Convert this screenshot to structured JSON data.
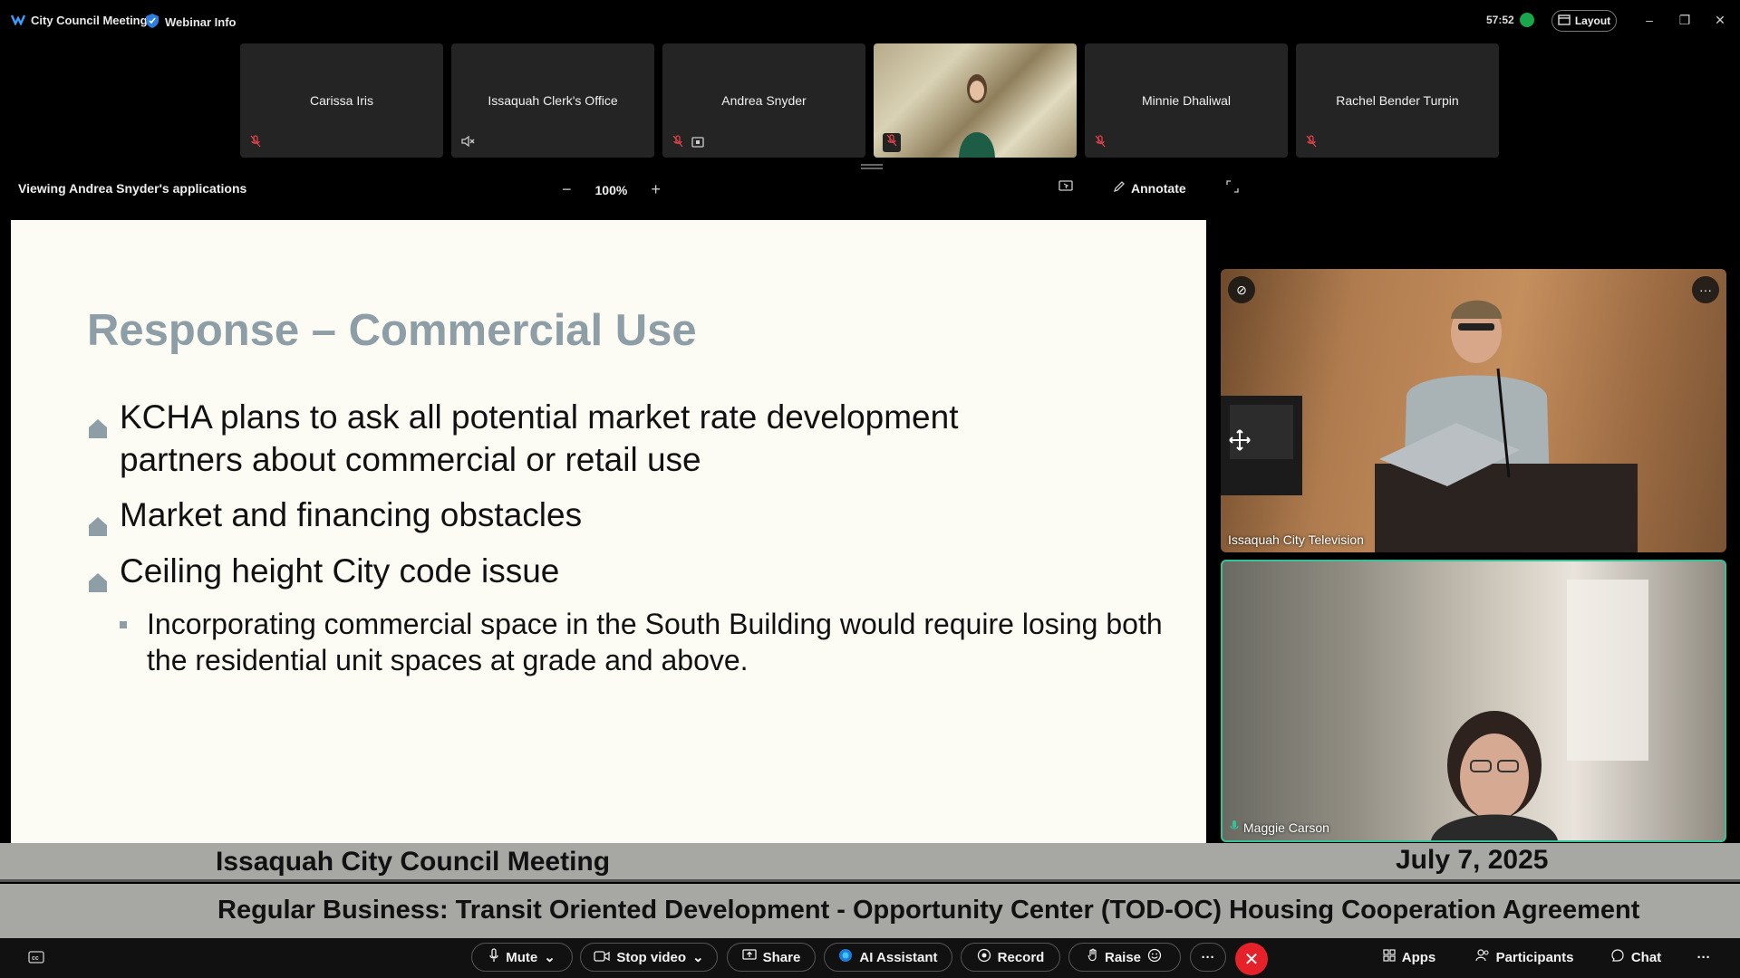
{
  "topbar": {
    "app_title": "City Council Meeting",
    "webinar_info": "Webinar Info",
    "timer": "57:52",
    "layout_label": "Layout"
  },
  "participants": [
    {
      "name": "Carissa Iris",
      "icon": "mic-muted-icon"
    },
    {
      "name": "Issaquah Clerk's Office",
      "icon": "speaker-muted-icon"
    },
    {
      "name": "Andrea Snyder",
      "icon": "mic-muted-icon"
    },
    {
      "name": "",
      "icon": "mic-muted-icon",
      "video": true
    },
    {
      "name": "Minnie Dhaliwal",
      "icon": "mic-muted-icon"
    },
    {
      "name": "Rachel Bender Turpin",
      "icon": "mic-muted-icon"
    }
  ],
  "share": {
    "viewing_label": "Viewing Andrea Snyder's applications",
    "zoom_level": "100%",
    "annotate_label": "Annotate"
  },
  "slide": {
    "title": "Response – Commercial Use",
    "bullets": [
      "KCHA plans to ask all potential market rate development partners about commercial or retail use",
      "Market and financing obstacles",
      "Ceiling height City code issue"
    ],
    "sub_bullet": "Incorporating commercial space in the South Building would require losing both the residential unit spaces at grade and above."
  },
  "videos": {
    "cam1_label": "Issaquah City Television",
    "cam2_label": "Maggie Carson"
  },
  "lower_third": {
    "meeting": "Issaquah City Council Meeting",
    "date": "July 7, 2025",
    "topic": "Regular Business: Transit Oriented Development - Opportunity Center (TOD-OC) Housing Cooperation Agreement"
  },
  "controls": {
    "mute": "Mute",
    "stop_video": "Stop video",
    "share": "Share",
    "ai_assistant": "AI Assistant",
    "record": "Record",
    "raise": "Raise",
    "apps": "Apps",
    "participants": "Participants",
    "chat": "Chat"
  },
  "colors": {
    "slide_title": "#8e9ea6",
    "active_speaker_border": "#35c29a",
    "end_call": "#e5212a",
    "banner_bg": "#a7a8a4"
  }
}
